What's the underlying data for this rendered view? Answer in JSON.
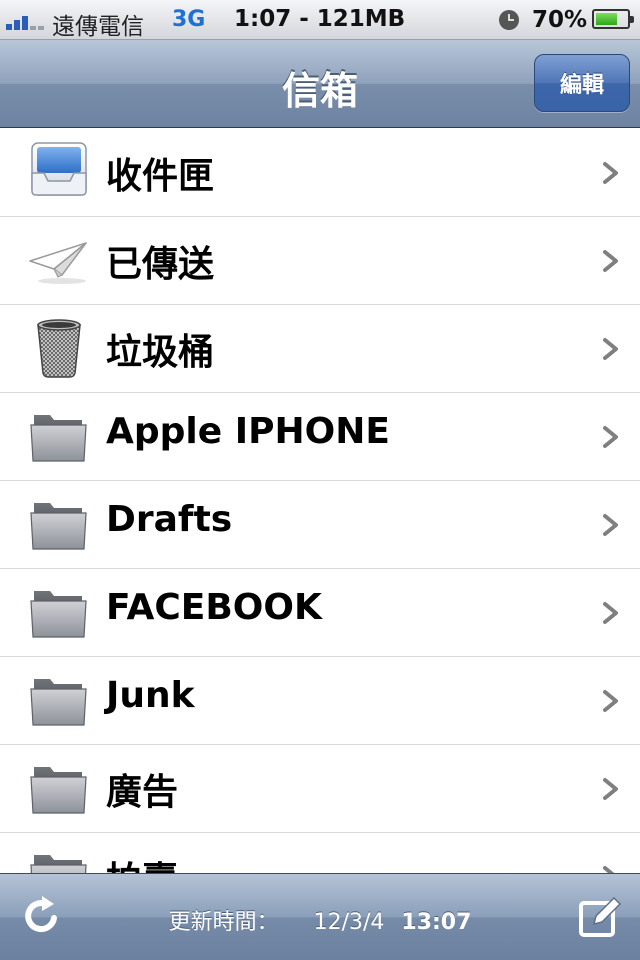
{
  "status_bar": {
    "carrier": "遠傳電信",
    "network": "3G",
    "time_info": "1:07 - 121MB",
    "battery_percent": "70%",
    "battery_level": 0.7,
    "signal_bars": 3
  },
  "nav": {
    "title": "信箱",
    "edit_label": "編輯"
  },
  "mailboxes": [
    {
      "label": "收件匣",
      "icon": "inbox-icon"
    },
    {
      "label": "已傳送",
      "icon": "sent-icon"
    },
    {
      "label": "垃圾桶",
      "icon": "trash-icon"
    },
    {
      "label": "Apple IPHONE",
      "icon": "folder-icon"
    },
    {
      "label": "Drafts",
      "icon": "folder-icon"
    },
    {
      "label": "FACEBOOK",
      "icon": "folder-icon"
    },
    {
      "label": "Junk",
      "icon": "folder-icon"
    },
    {
      "label": "廣告",
      "icon": "folder-icon"
    },
    {
      "label": "拍賣",
      "icon": "folder-icon"
    }
  ],
  "toolbar": {
    "updated_label": "更新時間：",
    "updated_date": "12/3/4",
    "updated_time": "13:07",
    "refresh_icon": "refresh-icon",
    "compose_icon": "compose-icon"
  },
  "colors": {
    "nav_blue": "#7a8eaa",
    "edit_button": "#3d66aa",
    "network_blue": "#1e6fd6"
  }
}
